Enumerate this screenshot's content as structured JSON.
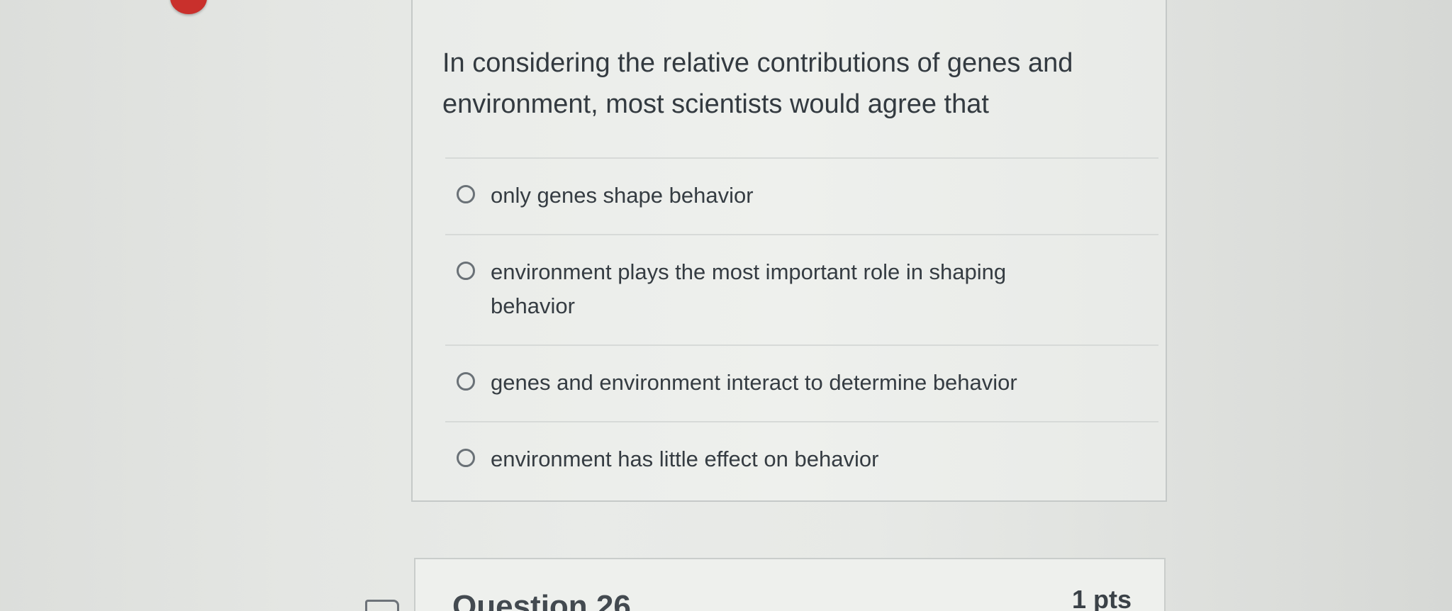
{
  "question": {
    "text": "In considering the relative contributions of genes and environment, most scientists would agree that",
    "answers": [
      {
        "label": "only genes shape behavior"
      },
      {
        "label": "environment plays the most important role in shaping behavior"
      },
      {
        "label": "genes and environment interact to determine behavior"
      },
      {
        "label": "environment has little effect on behavior"
      }
    ]
  },
  "next_question": {
    "title": "Question 26",
    "points": "1 pts"
  },
  "colors": {
    "notification": "#c9302c",
    "text": "#333a40",
    "border": "#c5c9c8"
  },
  "icons": {
    "notification": "notification-badge",
    "radio": "radio-circle-icon",
    "flag": "flag-icon"
  }
}
